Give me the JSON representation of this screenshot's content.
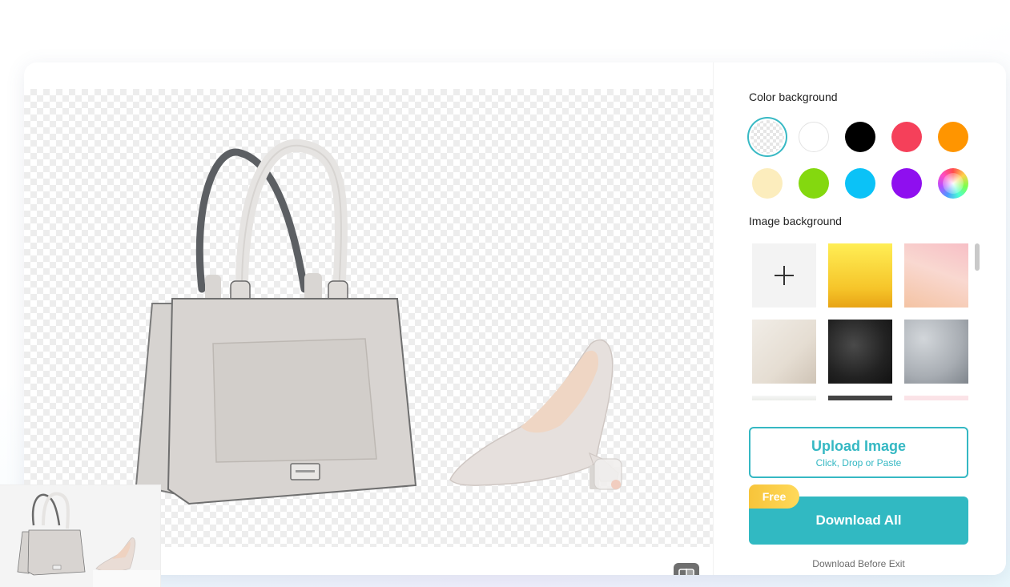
{
  "panel": {
    "color_background_title": "Color background",
    "image_background_title": "Image background"
  },
  "color_swatches": [
    {
      "name": "transparent",
      "color": "transparent",
      "selected": true
    },
    {
      "name": "white",
      "color": "#ffffff"
    },
    {
      "name": "black",
      "color": "#000000"
    },
    {
      "name": "red",
      "color": "#f5405a"
    },
    {
      "name": "orange",
      "color": "#ff9500"
    },
    {
      "name": "cream",
      "color": "#fcedbd"
    },
    {
      "name": "green",
      "color": "#84d80f"
    },
    {
      "name": "sky-blue",
      "color": "#0bc2f7"
    },
    {
      "name": "purple",
      "color": "#8f0fef"
    },
    {
      "name": "custom-rainbow",
      "color": "rainbow"
    }
  ],
  "image_backgrounds": [
    {
      "name": "add-image-background",
      "icon": "plus-icon"
    },
    {
      "name": "yellow-gradient",
      "colors": [
        "#ffe94d",
        "#f3b41a"
      ]
    },
    {
      "name": "pink-peach-watercolor",
      "colors": [
        "#f6c6c6",
        "#f4c4a6"
      ]
    },
    {
      "name": "beige-paper",
      "colors": [
        "#efebe4",
        "#d8d0c4"
      ]
    },
    {
      "name": "black-leather",
      "colors": [
        "#3a3a3a",
        "#141414"
      ]
    },
    {
      "name": "grey-concrete",
      "colors": [
        "#c2c7cc",
        "#8f959c"
      ]
    },
    {
      "name": "green-leaves",
      "colors": [
        "#f5f5f5",
        "#4e6b3a"
      ]
    },
    {
      "name": "dark-slate",
      "colors": [
        "#4a4a4a",
        "#2b2b2b"
      ]
    },
    {
      "name": "light-pink",
      "colors": [
        "#fbe3e6",
        "#f6d0d6"
      ]
    }
  ],
  "upload": {
    "title": "Upload Image",
    "subtitle": "Click, Drop or Paste"
  },
  "download": {
    "badge": "Free",
    "label": "Download All",
    "note": "Download Before Exit"
  },
  "colors": {
    "accent": "#31b9c2",
    "badge": "#f7c43a"
  }
}
